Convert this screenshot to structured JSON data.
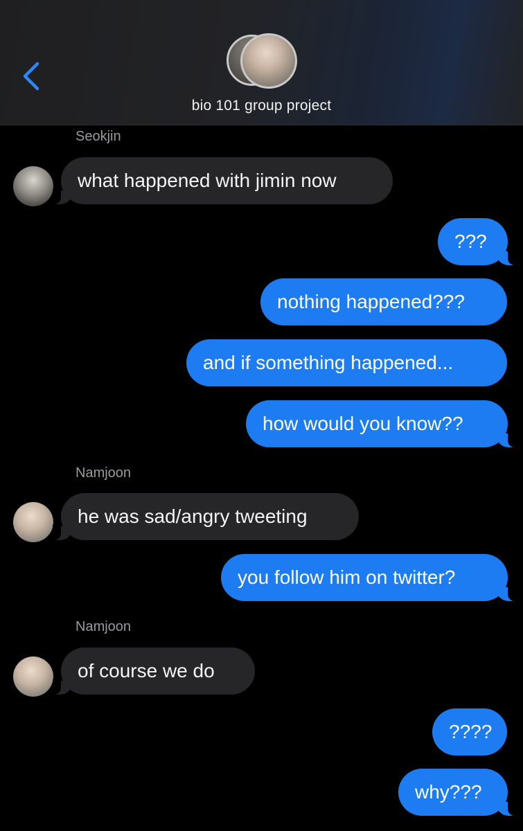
{
  "header": {
    "title": "bio 101 group project",
    "back_icon": "chevron-left-icon",
    "accent_color": "#2f86f6"
  },
  "thread": [
    {
      "type": "name",
      "text": "Seokjin"
    },
    {
      "type": "in",
      "sender": "Seokjin",
      "text": "what happened with jimin now"
    },
    {
      "type": "out",
      "text": "???"
    },
    {
      "type": "out",
      "text": "nothing happened???"
    },
    {
      "type": "out",
      "text": "and if something happened..."
    },
    {
      "type": "out",
      "text": "how would you know??"
    },
    {
      "type": "name",
      "text": "Namjoon"
    },
    {
      "type": "in",
      "sender": "Namjoon",
      "text": "he was sad/angry tweeting"
    },
    {
      "type": "out",
      "text": "you follow him on twitter?"
    },
    {
      "type": "name",
      "text": "Namjoon"
    },
    {
      "type": "in",
      "sender": "Namjoon",
      "text": "of course we do"
    },
    {
      "type": "out",
      "text": "????"
    },
    {
      "type": "out",
      "text": "why???"
    }
  ],
  "colors": {
    "outgoing_bubble": "#1e7cf2",
    "incoming_bubble": "#262629",
    "background": "#000000",
    "sender_name": "#9a9a9f"
  }
}
